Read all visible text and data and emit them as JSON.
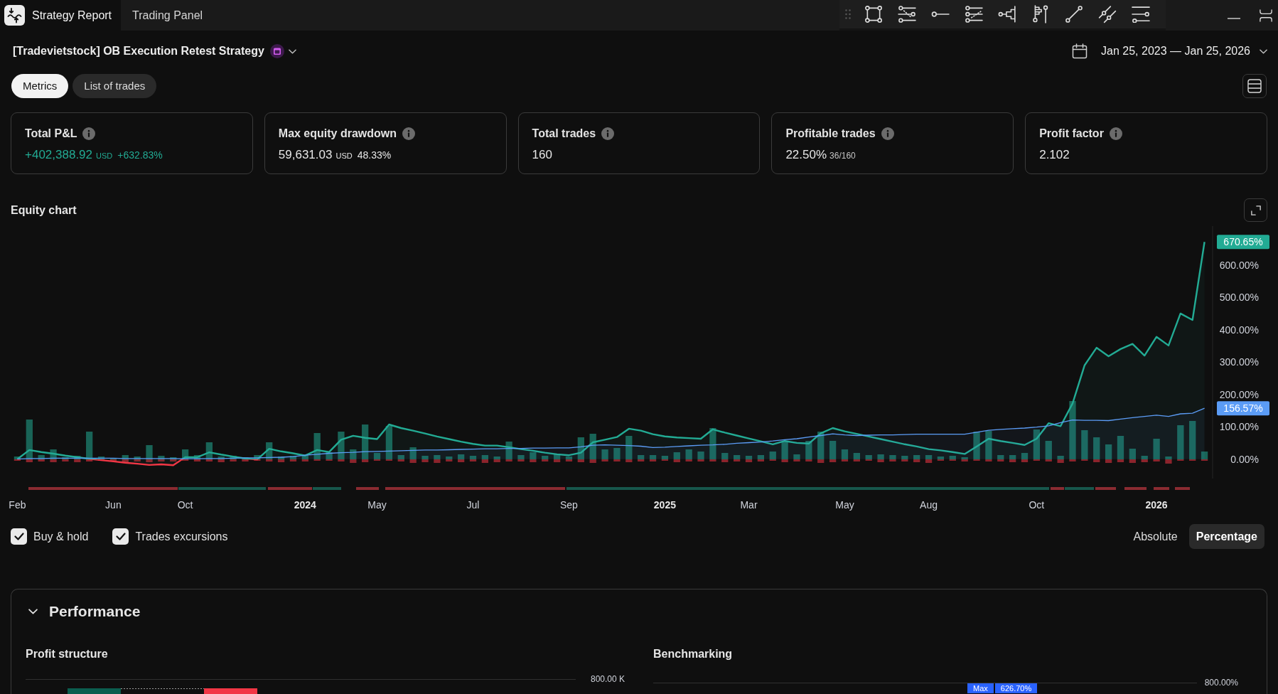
{
  "top_bar": {
    "tabs": [
      {
        "label": "Strategy Report",
        "selected": true
      },
      {
        "label": "Trading Panel",
        "selected": false
      }
    ]
  },
  "report": {
    "strategy_name": "[Tradevietstock] OB Execution Retest Strategy",
    "date_range": "Jan 25, 2023 — Jan 25, 2026",
    "tabs": [
      {
        "label": "Metrics",
        "selected": true
      },
      {
        "label": "List of trades",
        "selected": false
      }
    ]
  },
  "metrics": [
    {
      "title": "Total P&L",
      "value": "+402,388.92",
      "unit": "USD",
      "change": "+632.83%",
      "kind": "gain"
    },
    {
      "title": "Max equity drawdown",
      "value": "59,631.03",
      "unit": "USD",
      "change": "48.33%",
      "kind": "plain"
    },
    {
      "title": "Total trades",
      "value": "160",
      "kind": "plain"
    },
    {
      "title": "Profitable trades",
      "value": "22.50%",
      "ratio": "36/160",
      "kind": "plain"
    },
    {
      "title": "Profit factor",
      "value": "2.102",
      "kind": "plain"
    }
  ],
  "equity_chart": {
    "title": "Equity chart",
    "chart_data": {
      "type": "area",
      "categories": [
        "Feb",
        null,
        null,
        null,
        null,
        null,
        null,
        null,
        "Jun",
        null,
        null,
        null,
        null,
        null,
        "Oct",
        null,
        null,
        null,
        null,
        null,
        null,
        null,
        null,
        null,
        "2024",
        null,
        null,
        null,
        null,
        null,
        "May",
        null,
        null,
        null,
        null,
        null,
        null,
        null,
        "Jul",
        null,
        null,
        null,
        null,
        null,
        null,
        null,
        "Sep",
        null,
        null,
        null,
        null,
        null,
        null,
        null,
        "2025",
        null,
        null,
        null,
        null,
        null,
        null,
        "Mar",
        null,
        null,
        null,
        null,
        null,
        null,
        null,
        "May",
        null,
        null,
        null,
        null,
        null,
        null,
        "Aug",
        null,
        null,
        null,
        null,
        null,
        null,
        null,
        null,
        "Oct",
        null,
        null,
        null,
        null,
        null,
        null,
        null,
        null,
        null,
        "2026",
        null,
        null,
        null,
        null
      ],
      "ylim": [
        -60,
        720
      ],
      "yticks": [
        {
          "value": 0,
          "label": "0.00%"
        },
        {
          "value": 100,
          "label": "100.00%"
        },
        {
          "value": 200,
          "label": "200.00%"
        },
        {
          "value": 300,
          "label": "300.00%"
        },
        {
          "value": 400,
          "label": "400.00%"
        },
        {
          "value": 500,
          "label": "500.00%"
        },
        {
          "value": 600,
          "label": "600.00%"
        }
      ],
      "series": [
        {
          "color": "#22ab94",
          "values": [
            0,
            28,
            22,
            17,
            11,
            6,
            1,
            -3,
            -7,
            -11,
            -14,
            -18,
            -16,
            -19,
            6,
            6,
            21,
            14,
            8,
            2,
            -1,
            32,
            24,
            18,
            11,
            28,
            22,
            60,
            72,
            66,
            62,
            107,
            96,
            88,
            79,
            70,
            62,
            54,
            47,
            42,
            42,
            37,
            31,
            26,
            20,
            15,
            12,
            20,
            52,
            60,
            68,
            94,
            88,
            77,
            70,
            67,
            65,
            63,
            92,
            82,
            73,
            64,
            55,
            46,
            56,
            50,
            48,
            80,
            96,
            86,
            78,
            70,
            62,
            54,
            46,
            39,
            31,
            27,
            22,
            16,
            39,
            63,
            56,
            50,
            44,
            63,
            111,
            102,
            172,
            290,
            344,
            318,
            340,
            356,
            320,
            378,
            351,
            450,
            430,
            671
          ]
        },
        {
          "color": "#5b9cf6",
          "values": [
            0,
            2,
            2,
            3,
            3,
            3,
            3,
            3,
            3,
            2,
            2,
            2,
            2,
            2,
            1,
            1,
            2,
            2,
            3,
            4,
            4,
            5,
            6,
            8,
            12,
            15,
            18,
            20,
            21,
            23,
            24,
            25,
            26,
            27,
            28,
            28,
            29,
            30,
            31,
            32,
            32,
            33,
            33,
            34,
            34,
            35,
            35,
            38,
            43,
            44,
            43,
            42,
            40,
            36,
            37,
            39,
            41,
            43,
            44,
            46,
            49,
            51,
            53,
            56,
            60,
            63,
            68,
            73,
            78,
            75,
            73,
            74,
            75,
            75,
            76,
            77,
            77,
            77,
            77,
            77,
            83,
            89,
            92,
            94,
            96,
            99,
            103,
            113,
            121,
            120,
            120,
            119,
            124,
            128,
            132,
            136,
            132,
            140,
            142,
            157
          ]
        }
      ],
      "annotations": [
        "670.65%",
        "156.57%"
      ]
    },
    "options": [
      {
        "label": "Buy & hold",
        "checked": true
      },
      {
        "label": "Trades excursions",
        "checked": true
      }
    ],
    "scale_modes": [
      {
        "label": "Absolute",
        "selected": false
      },
      {
        "label": "Percentage",
        "selected": true
      }
    ]
  },
  "performance": {
    "title": "Performance",
    "expanded": true,
    "profit_structure": {
      "title": "Profit structure",
      "axis_label": "800.00 K"
    },
    "benchmarking": {
      "title": "Benchmarking",
      "axis_label": "800.00%",
      "labels": [
        "Max",
        "626.70%"
      ]
    }
  }
}
